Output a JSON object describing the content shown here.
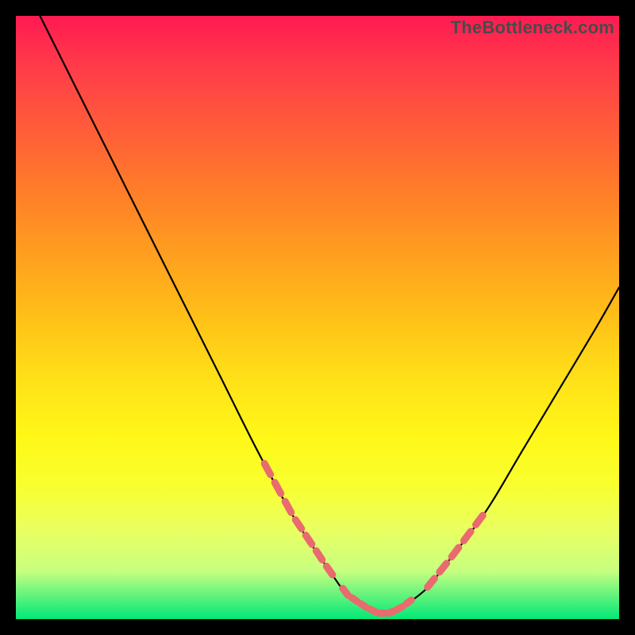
{
  "chart_data": {
    "type": "line",
    "title": "",
    "watermark": "TheBottleneck.com",
    "xlabel": "",
    "ylabel": "",
    "xlim": [
      0,
      100
    ],
    "ylim": [
      0,
      100
    ],
    "grid": false,
    "series": [
      {
        "name": "bottleneck-curve",
        "x": [
          4,
          10,
          16,
          22,
          28,
          34,
          40,
          46,
          52,
          55,
          58,
          60,
          62,
          64,
          68,
          72,
          78,
          84,
          90,
          96,
          100
        ],
        "y": [
          100,
          88,
          76,
          64,
          52,
          40,
          28,
          17,
          8,
          4,
          2,
          1,
          1,
          2,
          5,
          10,
          18,
          28,
          38,
          48,
          55
        ]
      }
    ],
    "highlight_dashes": {
      "left_descent": {
        "x_range": [
          41,
          53
        ],
        "dash_count": 7
      },
      "valley": {
        "x_range": [
          54,
          66
        ],
        "dash_count": 8
      },
      "right_ascent": {
        "x_range": [
          68,
          78
        ],
        "dash_count": 5
      }
    },
    "background_gradient": {
      "stops": [
        {
          "pos": 0.0,
          "color": "#ff1a52"
        },
        {
          "pos": 0.5,
          "color": "#ffc018"
        },
        {
          "pos": 0.78,
          "color": "#f8ff30"
        },
        {
          "pos": 1.0,
          "color": "#00e878"
        }
      ]
    },
    "colors": {
      "curve": "#000000",
      "highlight": "#e96a6f",
      "frame": "#000000"
    }
  }
}
